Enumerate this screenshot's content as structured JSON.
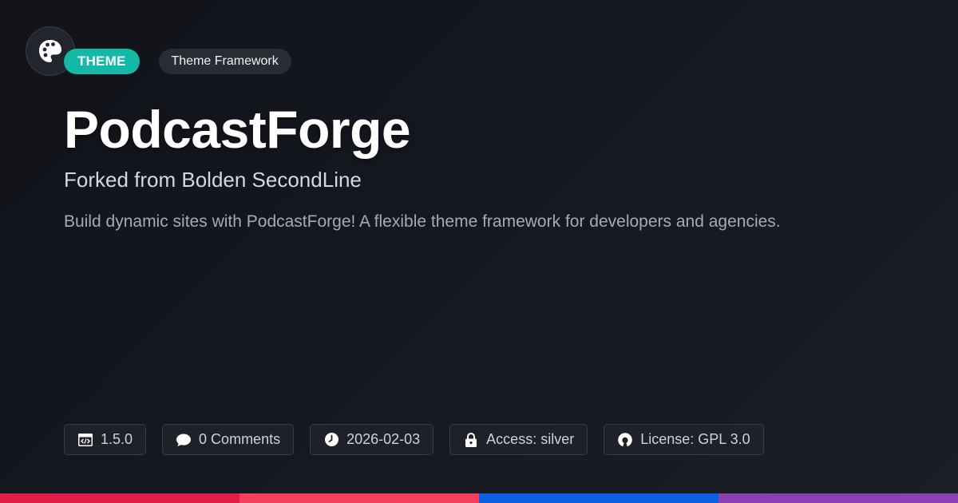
{
  "header": {
    "logo_icon": "palette-icon",
    "type_tag": "THEME",
    "category_tag": "Theme Framework"
  },
  "main": {
    "title": "PodcastForge",
    "subtitle": "Forked from Bolden SecondLine",
    "description": "Build dynamic sites with PodcastForge! A flexible theme framework for developers and agencies."
  },
  "meta": {
    "version": {
      "icon": "code-icon",
      "label": "1.5.0"
    },
    "comments": {
      "icon": "comment-icon",
      "label": "0 Comments"
    },
    "date": {
      "icon": "clock-icon",
      "label": "2026-02-03"
    },
    "access": {
      "icon": "lock-icon",
      "label": "Access: silver"
    },
    "license": {
      "icon": "open-source-icon",
      "label": "License: GPL 3.0"
    }
  },
  "colors": {
    "accent": "#14b8a6",
    "bar": [
      "#e11d48",
      "#f43f5e",
      "#0b5fe0",
      "#8b3fb5"
    ]
  }
}
